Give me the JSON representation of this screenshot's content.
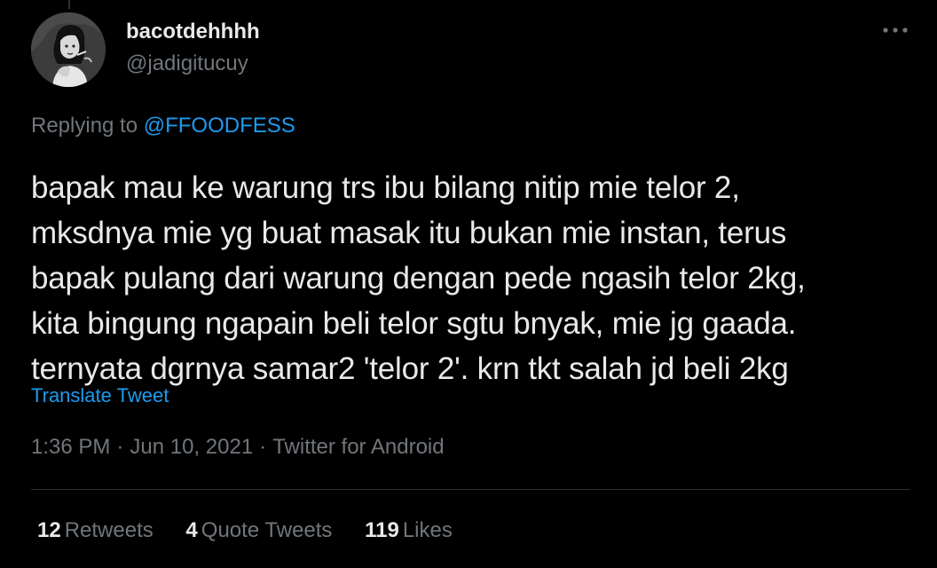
{
  "colors": {
    "background": "#000000",
    "text_primary": "#e7e9ea",
    "text_secondary": "#71767b",
    "link": "#1d9bf0",
    "divider": "#2f3336"
  },
  "author": {
    "display_name": "bacotdehhhh",
    "handle": "@jadigitucuy",
    "avatar_icon": "avatar-illustration-icon"
  },
  "more_icon": "more-horizontal-icon",
  "reply_context": {
    "prefix": "Replying to ",
    "mention": "@FFOODFESS"
  },
  "tweet": {
    "text": "bapak mau ke warung trs ibu bilang nitip mie telor 2,\nmksdnya mie yg buat masak itu bukan mie instan, terus\nbapak pulang dari warung dengan pede ngasih telor 2kg,\nkita bingung ngapain beli telor sgtu bnyak, mie jg gaada.\nternyata dgrnya samar2 'telor 2'. krn tkt salah jd beli 2kg",
    "translate_label": "Translate Tweet"
  },
  "meta": {
    "time": "1:36 PM",
    "separator": "·",
    "date": "Jun 10, 2021",
    "client": "Twitter for Android"
  },
  "stats": {
    "retweets_count": "12",
    "retweets_label": "Retweets",
    "quotes_count": "4",
    "quotes_label": "Quote Tweets",
    "likes_count": "119",
    "likes_label": "Likes"
  }
}
